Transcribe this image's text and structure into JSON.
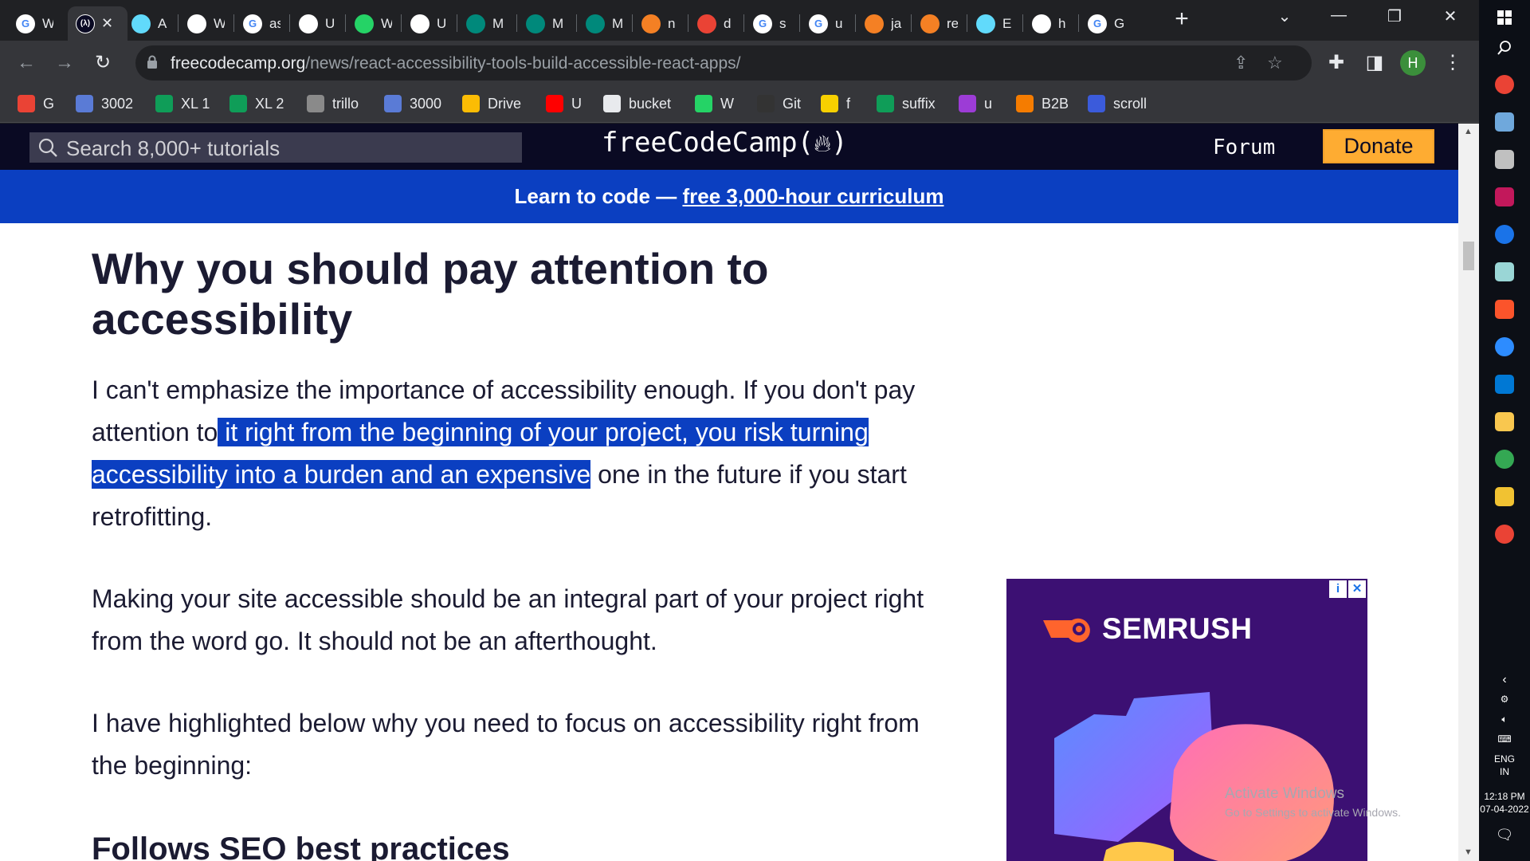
{
  "browser": {
    "tabs": [
      {
        "letter": "W",
        "icon": "google-icon",
        "color": "#ffffff"
      },
      {
        "letter": "",
        "icon": "freecodecamp-icon",
        "color": "#0a0a23",
        "active": true
      },
      {
        "letter": "A",
        "icon": "react-icon",
        "color": "#61dafb"
      },
      {
        "letter": "W",
        "icon": "w3schools-icon",
        "color": "#ffffff"
      },
      {
        "letter": "as",
        "icon": "google-icon",
        "color": "#ffffff"
      },
      {
        "letter": "U",
        "icon": "site-icon",
        "color": "#ffffff"
      },
      {
        "letter": "W",
        "icon": "whatsapp-icon",
        "color": "#25d366"
      },
      {
        "letter": "U",
        "icon": "site-icon",
        "color": "#ffffff"
      },
      {
        "letter": "M",
        "icon": "meet-icon",
        "color": "#00897b"
      },
      {
        "letter": "M",
        "icon": "meet-icon",
        "color": "#00897b"
      },
      {
        "letter": "M",
        "icon": "meet-icon",
        "color": "#00897b"
      },
      {
        "letter": "n",
        "icon": "stackoverflow-icon",
        "color": "#f48024"
      },
      {
        "letter": "d",
        "icon": "gmail-icon",
        "color": "#ea4335"
      },
      {
        "letter": "s",
        "icon": "google-icon",
        "color": "#ffffff"
      },
      {
        "letter": "u",
        "icon": "google-icon",
        "color": "#ffffff"
      },
      {
        "letter": "ja",
        "icon": "stackoverflow-icon",
        "color": "#f48024"
      },
      {
        "letter": "re",
        "icon": "stackoverflow-icon",
        "color": "#f48024"
      },
      {
        "letter": "E",
        "icon": "react-icon",
        "color": "#61dafb"
      },
      {
        "letter": "h",
        "icon": "github-icon",
        "color": "#ffffff"
      },
      {
        "letter": "G",
        "icon": "google-icon",
        "color": "#ffffff"
      }
    ],
    "url_host": "freecodecamp.org",
    "url_path": "/news/react-accessibility-tools-build-accessible-react-apps/",
    "profile_initial": "H",
    "bookmarks": [
      {
        "label": "G",
        "icon": "gmail-icon",
        "color": "#ea4335"
      },
      {
        "label": "3002",
        "icon": "site-icon",
        "color": "#5a7bd6"
      },
      {
        "label": "XL 1",
        "icon": "sheets-icon",
        "color": "#0f9d58"
      },
      {
        "label": "XL 2",
        "icon": "sheets-icon",
        "color": "#0f9d58"
      },
      {
        "label": "trillo",
        "icon": "site-icon",
        "color": "#8a8a8a"
      },
      {
        "label": "3000",
        "icon": "site-icon",
        "color": "#5a7bd6"
      },
      {
        "label": "Drive",
        "icon": "drive-icon",
        "color": "#fbbc04"
      },
      {
        "label": "U",
        "icon": "youtube-icon",
        "color": "#ff0000"
      },
      {
        "label": "bucket",
        "icon": "globe-icon",
        "color": "#e8eaed"
      },
      {
        "label": "W",
        "icon": "whatsapp-icon",
        "color": "#25d366"
      },
      {
        "label": "Git",
        "icon": "github-icon",
        "color": "#333333"
      },
      {
        "label": "f",
        "icon": "flipkart-icon",
        "color": "#f7d000"
      },
      {
        "label": "suffix",
        "icon": "sheets-icon",
        "color": "#0f9d58"
      },
      {
        "label": "u",
        "icon": "site-icon",
        "color": "#9c3cd6"
      },
      {
        "label": "B2B",
        "icon": "site-icon",
        "color": "#f57c00"
      },
      {
        "label": "scroll",
        "icon": "site-icon",
        "color": "#3b5bdb"
      }
    ]
  },
  "page": {
    "search_placeholder": "Search 8,000+ tutorials",
    "logo": "freeCodeCamp(",
    "logo_end": ")",
    "forum": "Forum",
    "donate": "Donate",
    "banner_prefix": "Learn to code — ",
    "banner_link": "free 3,000-hour curriculum",
    "heading": "Why you should pay attention to accessibility",
    "p1_before": "I can't emphasize the importance of accessibility enough. If you don't pay attention to",
    "p1_highlight": " it right from the beginning of your project, you risk turning accessibility into a burden and an expensive",
    "p1_after": " one in the future if you start retrofitting.",
    "p2": "Making your site accessible should be an integral part of your project right from the word go. It should not be an afterthought.",
    "p3": "I have highlighted below why you need to focus on accessibility right from the beginning:",
    "subheading": "Follows SEO best practices",
    "ad_brand": "SEMRUSH",
    "ad_info": "i",
    "ad_close": "✕",
    "watermark_title": "Activate Windows",
    "watermark_sub": "Go to Settings to activate Windows."
  },
  "taskbar": {
    "lang": "ENG",
    "region": "IN",
    "time": "12:18 PM",
    "date": "07-04-2022"
  },
  "colors": {
    "fcc_nav": "#0a0a23",
    "banner": "#0b3fc1",
    "highlight": "#0b3fc1",
    "donate": "#feac32",
    "ad_bg": "#3c1073"
  }
}
